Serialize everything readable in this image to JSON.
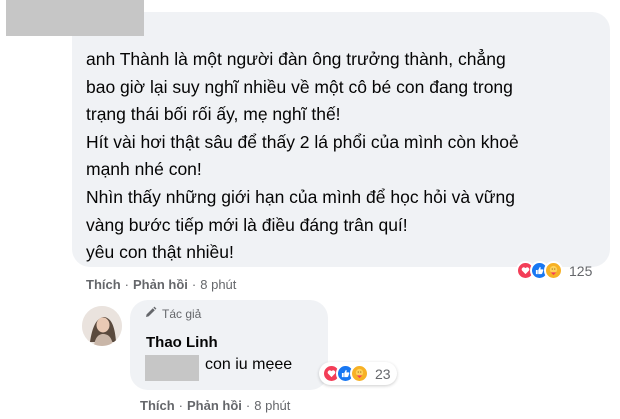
{
  "comment": {
    "lines": [
      "anh Thành là một người đàn ông trưởng thành, chẳng",
      "bao giờ lại suy nghĩ nhiều về một cô bé con đang trong",
      "trạng thái bối rối ấy, mẹ nghĩ thế!",
      "Hít vài hơi thật sâu để thấy 2 lá phổi của mình còn khoẻ",
      "mạnh nhé con!",
      "Nhìn thấy những giới hạn của mình để học hỏi và vững",
      "vàng bước tiếp mới là điều đáng trân quí!",
      "yêu con thật nhiều!"
    ],
    "actions": {
      "like_label": "Thích",
      "reply_label": "Phản hồi",
      "separator": "·",
      "time": "8 phút"
    },
    "reactions": {
      "icons": [
        "love",
        "like",
        "care"
      ],
      "count": "125"
    }
  },
  "reply": {
    "badge": "Tác giả",
    "author": "Thao Linh",
    "text": "con iu mẹee",
    "reactions": {
      "icons": [
        "love",
        "like",
        "care"
      ],
      "count": "23"
    },
    "actions": {
      "like_label": "Thích",
      "reply_label": "Phản hồi",
      "separator": "·",
      "time": "8 phút"
    }
  },
  "colors": {
    "bubble_bg": "#f0f2f5",
    "secondary_text": "#65676b",
    "love": "#f33e58",
    "like": "#1877f2",
    "care": "#f7b125",
    "redaction": "#c6c6c6"
  }
}
